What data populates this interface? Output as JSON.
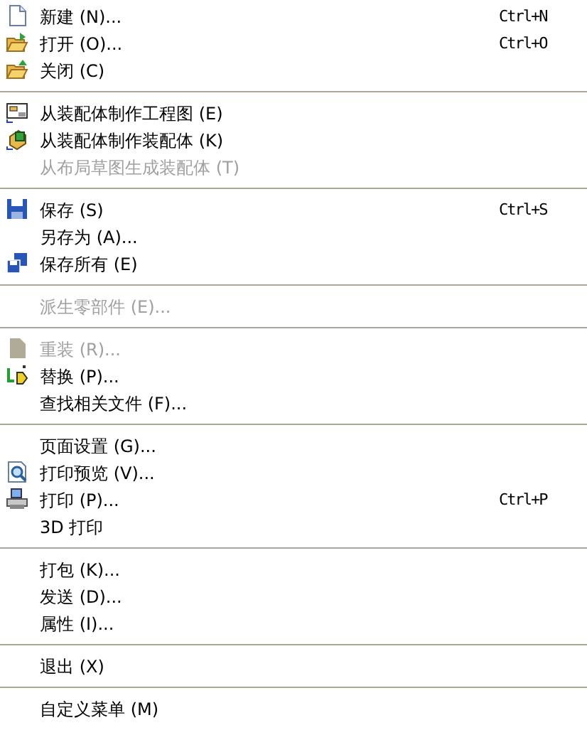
{
  "menu": {
    "sections": [
      {
        "items": [
          {
            "label": "新建 (N)...",
            "shortcut": "Ctrl+N",
            "disabled": false
          },
          {
            "label": "打开 (O)...",
            "shortcut": "Ctrl+O",
            "disabled": false
          },
          {
            "label": "关闭 (C)",
            "disabled": false
          }
        ]
      },
      {
        "items": [
          {
            "label": "从装配体制作工程图 (E)",
            "disabled": false
          },
          {
            "label": "从装配体制作装配体 (K)",
            "disabled": false
          },
          {
            "label": "从布局草图生成装配体 (T)",
            "disabled": true
          }
        ]
      },
      {
        "items": [
          {
            "label": "保存 (S)",
            "shortcut": "Ctrl+S",
            "disabled": false
          },
          {
            "label": "另存为 (A)...",
            "disabled": false
          },
          {
            "label": "保存所有 (E)",
            "disabled": false
          }
        ]
      },
      {
        "items": [
          {
            "label": "派生零部件 (E)...",
            "disabled": true
          }
        ]
      },
      {
        "items": [
          {
            "label": "重装 (R)...",
            "disabled": true
          },
          {
            "label": "替换 (P)...",
            "disabled": false
          },
          {
            "label": "查找相关文件 (F)...",
            "disabled": false
          }
        ]
      },
      {
        "items": [
          {
            "label": "页面设置 (G)...",
            "disabled": false
          },
          {
            "label": "打印预览 (V)...",
            "disabled": false
          },
          {
            "label": "打印 (P)...",
            "shortcut": "Ctrl+P",
            "disabled": false
          },
          {
            "label": "3D 打印",
            "disabled": false
          }
        ]
      },
      {
        "items": [
          {
            "label": "打包 (K)...",
            "disabled": false
          },
          {
            "label": "发送 (D)...",
            "disabled": false
          },
          {
            "label": "属性 (I)...",
            "disabled": false
          }
        ]
      },
      {
        "items": [
          {
            "label": "退出 (X)",
            "disabled": false
          }
        ]
      },
      {
        "items": [
          {
            "label": "自定义菜单 (M)",
            "disabled": false
          }
        ]
      }
    ]
  }
}
